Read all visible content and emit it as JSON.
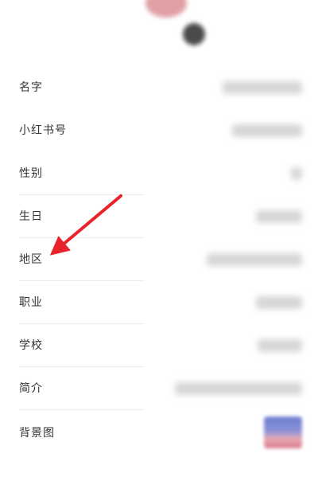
{
  "profile": {
    "fields": [
      {
        "label": "名字"
      },
      {
        "label": "小红书号"
      },
      {
        "label": "性别"
      },
      {
        "label": "生日"
      },
      {
        "label": "地区"
      },
      {
        "label": "职业"
      },
      {
        "label": "学校"
      },
      {
        "label": "简介"
      },
      {
        "label": "背景图"
      }
    ]
  },
  "annotation": {
    "arrow_color": "#e8242a",
    "points_to": "地区"
  },
  "colors": {
    "background": "#ffffff",
    "label_text": "#333333",
    "divider": "#ececec"
  }
}
